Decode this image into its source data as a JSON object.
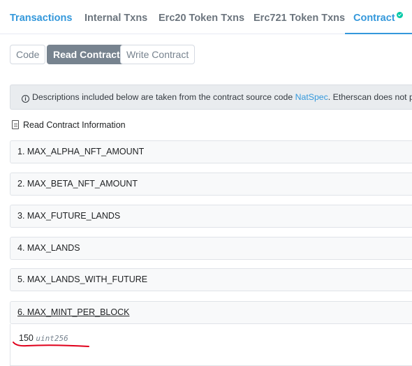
{
  "tabs": [
    {
      "label": "Transactions",
      "state": "blue"
    },
    {
      "label": "Internal Txns"
    },
    {
      "label": "Erc20 Token Txns"
    },
    {
      "label": "Erc721 Token Txns"
    },
    {
      "label": "Contract",
      "state": "active",
      "verified_icon": "check-circle-icon"
    }
  ],
  "sub_buttons": [
    "Code",
    "Read Contract",
    "Write Contract"
  ],
  "active_sub_button": "Read Contract",
  "banner": {
    "icon": "info-circle-icon",
    "text_before": "Descriptions included below are taken from the contract source code ",
    "link": "NatSpec",
    "text_after": ". Etherscan does not provide any guarantees on their safety or accuracy."
  },
  "heading": {
    "icon": "document-icon",
    "text": "Read Contract Information"
  },
  "functions": [
    "1. MAX_ALPHA_NFT_AMOUNT",
    "2. MAX_BETA_NFT_AMOUNT",
    "3. MAX_FUTURE_LANDS",
    "4. MAX_LANDS",
    "5. MAX_LANDS_WITH_FUTURE",
    "6. MAX_MINT_PER_BLOCK"
  ],
  "result": {
    "value": "150",
    "type": "uint256"
  },
  "colors": {
    "link": "#3498db",
    "active_button": "#77838f",
    "verified": "#00c9a7",
    "annotation": "#e0001b"
  }
}
